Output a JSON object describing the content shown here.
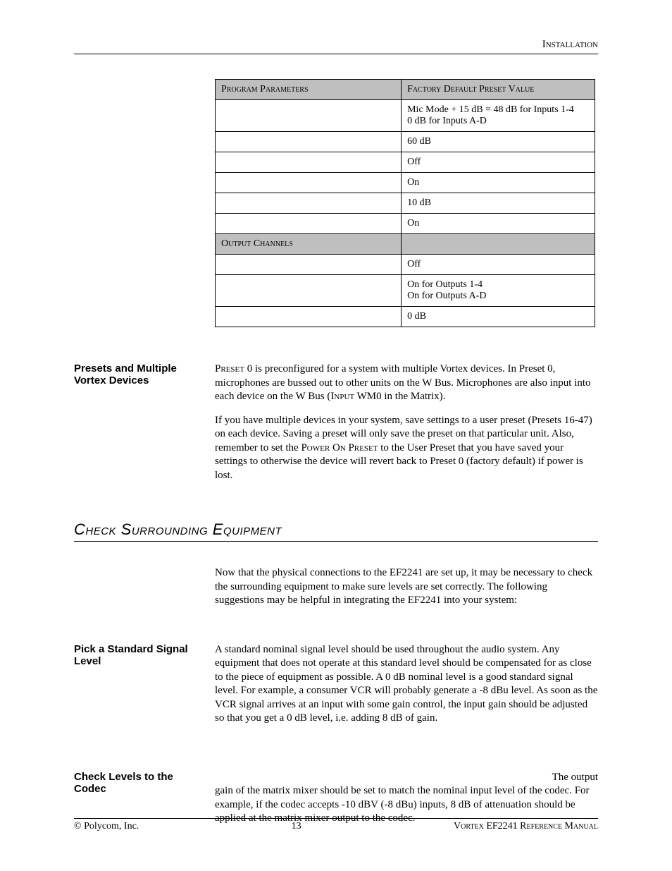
{
  "header": {
    "right": "Installation"
  },
  "table": {
    "headers": [
      "Program Parameters",
      "Factory Default Preset Value"
    ],
    "rows": [
      [
        "",
        "Mic Mode + 15 dB = 48 dB for Inputs 1-4\n0 dB for Inputs A-D"
      ],
      [
        "",
        "60 dB"
      ],
      [
        "",
        "Off"
      ],
      [
        "",
        "On"
      ],
      [
        "",
        "10 dB"
      ],
      [
        "",
        "On"
      ]
    ],
    "subheader": [
      "Output Channels",
      ""
    ],
    "rows2": [
      [
        "",
        "Off"
      ],
      [
        "",
        "On for Outputs 1-4\nOn for Outputs A-D"
      ],
      [
        "",
        "0 dB"
      ]
    ]
  },
  "sections": {
    "presets": {
      "title": "Presets and Multiple Vortex Devices",
      "p1_a": "Preset",
      "p1_b": " 0 is preconfigured for a system with multiple Vortex devices.  In Preset 0, microphones are bussed out to other units on the W Bus.  Microphones are also input into each device on the W Bus (",
      "p1_c": "Input",
      "p1_d": " WM0 in the Matrix).",
      "p2_a": "If you have multiple devices in your system, save settings to a user preset (Presets 16-47) on each device.  Saving a preset will only save the preset on that particular unit.  Also, remember to set the ",
      "p2_b": "Power On Preset",
      "p2_c": " to the User Preset that you have saved your settings to otherwise the device will revert back to Preset 0 (factory default) if power is lost."
    },
    "check_heading": "Check Surrounding Equipment",
    "check_intro": "Now that the physical connections to the EF2241 are set up, it may be necessary to check the surrounding equipment to make sure levels are set correctly.  The following suggestions may be helpful in integrating the EF2241 into your system:",
    "pick": {
      "title": "Pick a Standard Signal Level",
      "body": "A standard nominal signal level should be used throughout the audio system.  Any equipment that does not operate at this standard level should be compensated for as close to the piece of equipment as possible.  A 0 dB nominal level is a good standard signal level.  For example, a consumer VCR will probably generate a -8 dBu level.  As soon as the VCR signal arrives at an input with some gain control, the input gain should be adjusted so that you get a 0 dB level, i.e. adding 8 dB of gain."
    },
    "codec": {
      "title": "Check Levels to the Codec",
      "lead": "The output",
      "rest": "gain of the matrix mixer should be set to match the nominal input level of the codec.  For example, if the codec accepts -10 dBV (-8 dBu) inputs, 8 dB of attenuation should be applied at the matrix mixer output to the codec."
    }
  },
  "footer": {
    "left": "© Polycom, Inc.",
    "center": "13",
    "right": "Vortex EF2241 Reference Manual"
  }
}
